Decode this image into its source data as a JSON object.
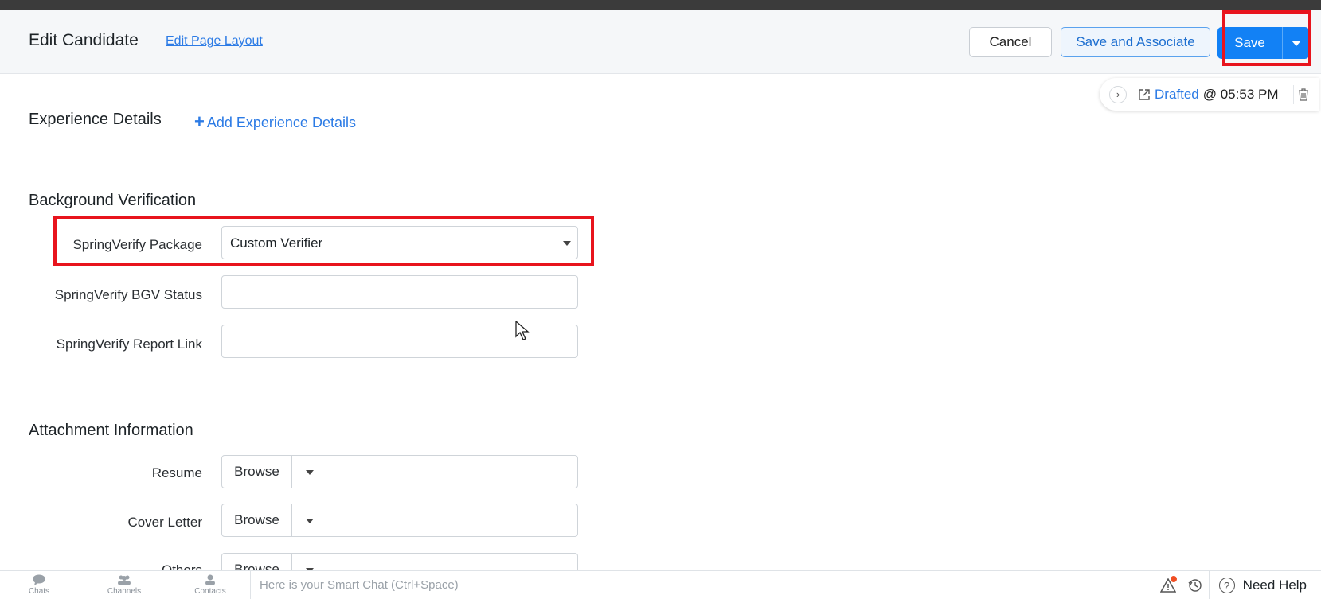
{
  "header": {
    "title": "Edit Candidate",
    "edit_layout_link": "Edit Page Layout",
    "cancel_label": "Cancel",
    "save_associate_label": "Save and Associate",
    "save_label": "Save"
  },
  "draft": {
    "status_link": "Drafted",
    "time": "@ 05:53 PM"
  },
  "sections": {
    "experience": {
      "title": "Experience Details",
      "add_label": "Add Experience Details"
    },
    "background": {
      "title": "Background Verification",
      "fields": [
        {
          "label": "SpringVerify Package",
          "value": "Custom Verifier"
        },
        {
          "label": "SpringVerify BGV Status",
          "value": ""
        },
        {
          "label": "SpringVerify Report Link",
          "value": ""
        }
      ]
    },
    "attachments": {
      "title": "Attachment Information",
      "browse_label": "Browse",
      "fields": [
        {
          "label": "Resume"
        },
        {
          "label": "Cover Letter"
        },
        {
          "label": "Others"
        }
      ]
    }
  },
  "bottombar": {
    "items": [
      {
        "label": "Chats",
        "icon": "chat-icon"
      },
      {
        "label": "Channels",
        "icon": "channels-icon"
      },
      {
        "label": "Contacts",
        "icon": "contacts-icon"
      }
    ],
    "chat_placeholder": "Here is your Smart Chat (Ctrl+Space)",
    "help_label": "Need Help"
  },
  "colors": {
    "accent": "#1281f5",
    "link": "#2c7be5",
    "highlight": "#e8141d"
  }
}
